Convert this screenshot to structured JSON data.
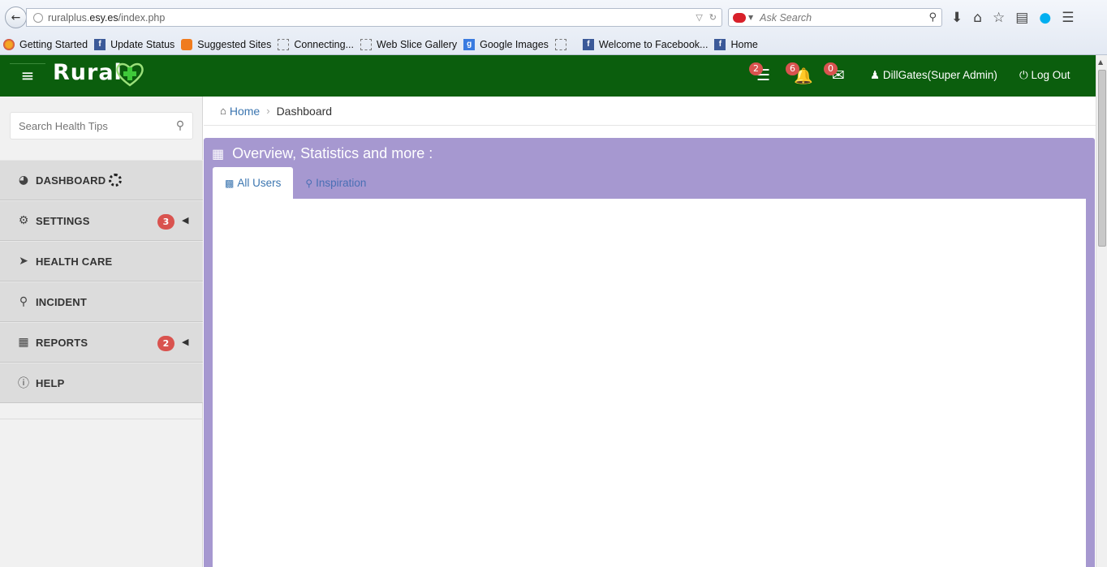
{
  "browser": {
    "url_prefix": "ruralplus.",
    "url_domain": "esy.es",
    "url_suffix": "/index.php",
    "search_placeholder": "Ask Search",
    "bookmarks": [
      {
        "label": "Getting Started",
        "icon": "firefox-icon"
      },
      {
        "label": "Update Status",
        "icon": "facebook-icon"
      },
      {
        "label": "Suggested Sites",
        "icon": "suggested-sites-icon"
      },
      {
        "label": "Connecting...",
        "icon": "web-slice-icon"
      },
      {
        "label": "Web Slice Gallery",
        "icon": "web-slice-icon"
      },
      {
        "label": "Google Images",
        "icon": "google-icon"
      },
      {
        "label": "",
        "icon": "web-slice-icon"
      },
      {
        "label": "Welcome to Facebook...",
        "icon": "facebook-icon"
      },
      {
        "label": "Home",
        "icon": "facebook-icon"
      }
    ]
  },
  "header": {
    "logo_text": "Rural",
    "messages_count": "2",
    "notifications_count": "6",
    "mail_count": "0",
    "user_label": "DillGates(Super Admin)",
    "logout_label": "Log Out",
    "brand_color": "#0b5e0d"
  },
  "sidebar": {
    "search_placeholder": "Search Health Tips",
    "items": [
      {
        "label": "DASHBOARD",
        "icon": "dashboard-icon",
        "badge": ""
      },
      {
        "label": "SETTINGS",
        "icon": "cogs-icon",
        "badge": "3"
      },
      {
        "label": "HEALTH CARE",
        "icon": "location-arrow-icon",
        "badge": ""
      },
      {
        "label": "INCIDENT",
        "icon": "map-marker-icon",
        "badge": ""
      },
      {
        "label": "REPORTS",
        "icon": "table-icon",
        "badge": "2"
      },
      {
        "label": "HELP",
        "icon": "info-circle-icon",
        "badge": ""
      }
    ]
  },
  "breadcrumb": {
    "home": "Home",
    "current": "Dashboard"
  },
  "panel": {
    "title": "Overview, Statistics and more :",
    "color": "#a698d0",
    "tabs": [
      {
        "label": "All Users",
        "icon": "bar-chart-icon"
      },
      {
        "label": "Inspiration",
        "icon": "search-plus-icon"
      }
    ]
  }
}
